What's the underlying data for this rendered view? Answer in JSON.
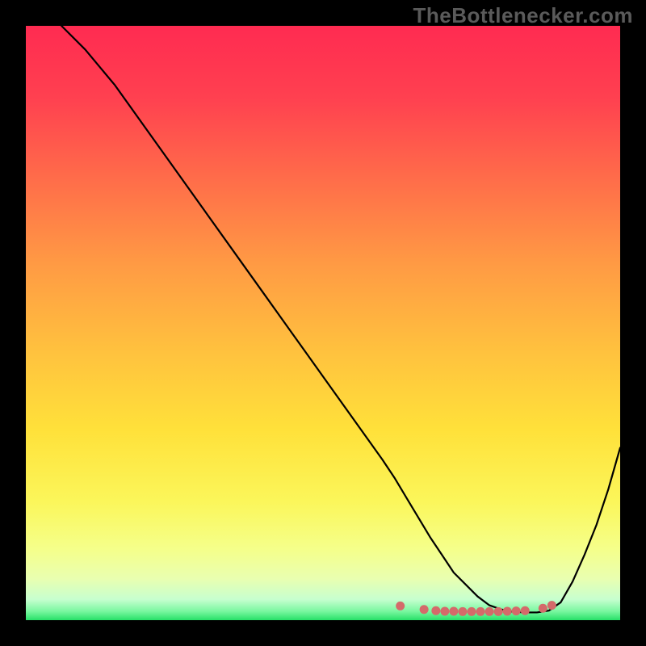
{
  "watermark": "TheBottlenecker.com",
  "colors": {
    "bg": "#000000",
    "curve": "#000000",
    "dots": "#d46a6a",
    "gradient_stops": [
      {
        "offset": 0.0,
        "color": "#ff2b51"
      },
      {
        "offset": 0.12,
        "color": "#ff4050"
      },
      {
        "offset": 0.25,
        "color": "#ff6a4a"
      },
      {
        "offset": 0.4,
        "color": "#ff9a44"
      },
      {
        "offset": 0.55,
        "color": "#ffc23e"
      },
      {
        "offset": 0.68,
        "color": "#ffe13a"
      },
      {
        "offset": 0.8,
        "color": "#fbf65a"
      },
      {
        "offset": 0.88,
        "color": "#f5ff8a"
      },
      {
        "offset": 0.93,
        "color": "#e9ffb0"
      },
      {
        "offset": 0.965,
        "color": "#c7ffcf"
      },
      {
        "offset": 0.985,
        "color": "#7af7a0"
      },
      {
        "offset": 1.0,
        "color": "#27e068"
      }
    ]
  },
  "chart_data": {
    "type": "line",
    "title": "",
    "xlabel": "",
    "ylabel": "",
    "xlim": [
      0,
      100
    ],
    "ylim": [
      0,
      100
    ],
    "grid": false,
    "legend": false,
    "series": [
      {
        "name": "bottleneck-curve",
        "x": [
          6,
          10,
          15,
          20,
          25,
          30,
          35,
          40,
          45,
          50,
          55,
          60,
          62,
          65,
          68,
          70,
          72,
          74,
          76,
          78,
          80,
          82,
          84,
          86,
          88,
          90,
          92,
          94,
          96,
          98,
          100
        ],
        "y": [
          100,
          96,
          90,
          83,
          76,
          69,
          62,
          55,
          48,
          41,
          34,
          27,
          24,
          19,
          14,
          11,
          8,
          6,
          4,
          2.5,
          1.8,
          1.4,
          1.3,
          1.3,
          1.6,
          3,
          6.5,
          11,
          16,
          22,
          29
        ]
      }
    ],
    "dots": {
      "name": "optimal-range",
      "x": [
        63,
        67,
        69,
        70.5,
        72,
        73.5,
        75,
        76.5,
        78,
        79.5,
        81,
        82.5,
        84,
        87,
        88.5
      ],
      "y": [
        2.4,
        1.8,
        1.6,
        1.5,
        1.5,
        1.45,
        1.45,
        1.45,
        1.45,
        1.45,
        1.5,
        1.55,
        1.6,
        2.0,
        2.5
      ]
    }
  }
}
